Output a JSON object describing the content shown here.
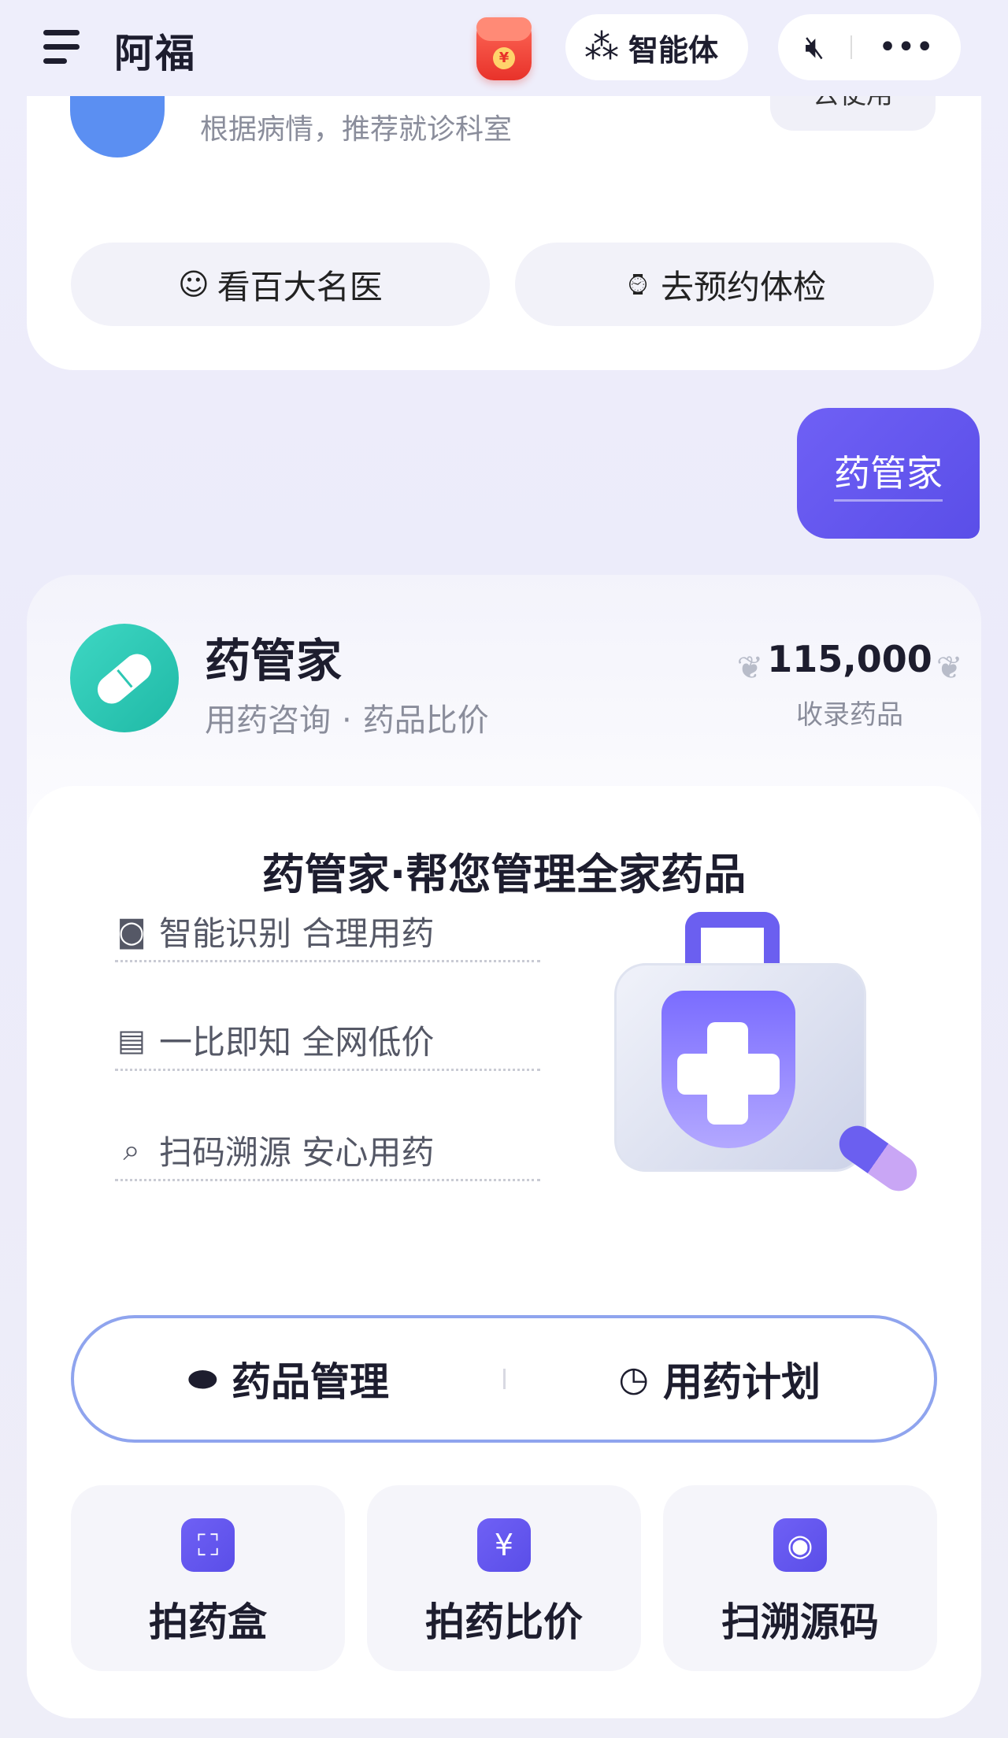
{
  "header": {
    "app_title": "阿福",
    "agent_label": "智能体",
    "icons": [
      "menu-icon",
      "red-packet-icon",
      "agent-icon",
      "mute-icon",
      "more-icon"
    ]
  },
  "dept_card": {
    "subtitle": "根据病情，推荐就诊科室",
    "use_label": "去使用",
    "actions": [
      {
        "label": "看百大名医",
        "icon": "doctor-icon"
      },
      {
        "label": "去预约体检",
        "icon": "checkup-icon"
      }
    ]
  },
  "chat": {
    "user_message": "药管家"
  },
  "med_card": {
    "title": "药管家",
    "subtitle_part1": "用药咨询",
    "subtitle_dot": "·",
    "subtitle_part2": "药品比价",
    "count": "115,000",
    "count_label": "收录药品",
    "inner_title": "药管家·帮您管理全家药品",
    "features": [
      {
        "label": "智能识别 合理用药",
        "icon": "camera-icon"
      },
      {
        "label": "一比即知 全网低价",
        "icon": "list-icon"
      },
      {
        "label": "扫码溯源 安心用药",
        "icon": "scan-icon"
      }
    ],
    "segments": [
      {
        "label": "药品管理",
        "icon": "pill-icon"
      },
      {
        "label": "用药计划",
        "icon": "clock-icon"
      }
    ],
    "tiles": [
      {
        "label": "拍药盒",
        "icon": "scan-frame-icon"
      },
      {
        "label": "拍药比价",
        "icon": "price-icon"
      },
      {
        "label": "扫溯源码",
        "icon": "target-icon"
      }
    ],
    "accent_color": "#5a4ee8",
    "teal_color": "#1fb9a6"
  }
}
